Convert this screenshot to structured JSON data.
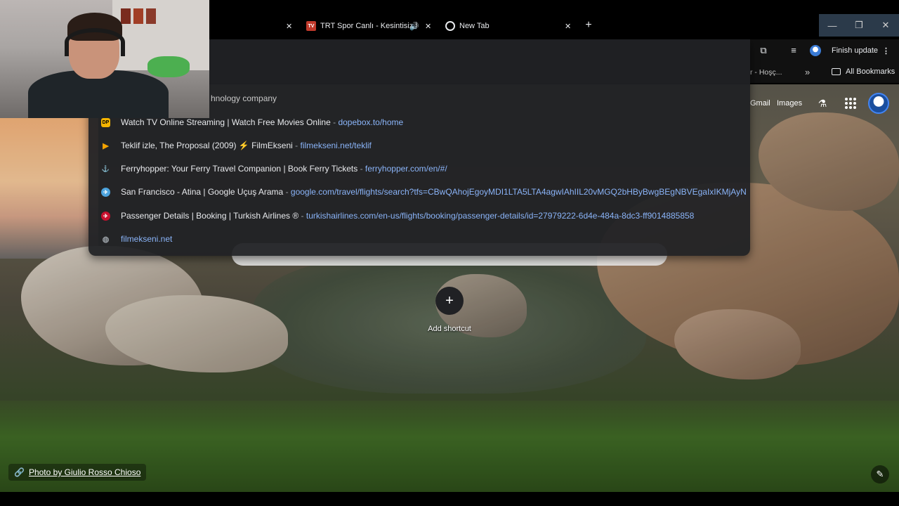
{
  "tabs": [
    {
      "title": "",
      "favicon": ""
    },
    {
      "title": "TRT Spor Canlı - Kesintisiz İzle",
      "favicon": "TV",
      "favicon_color": "#c0392b",
      "audio": true
    },
    {
      "title": "New Tab",
      "favicon": "chrome-icon",
      "active": true
    }
  ],
  "toolbar": {
    "finish_update_label": "Finish update",
    "omnibox_text": "Technology company"
  },
  "bookmarks_bar": {
    "visible_item": "r - Hoşç...",
    "all_bookmarks_label": "All Bookmarks"
  },
  "omnibox": {
    "hint_text": "hnology company",
    "suggestions": [
      {
        "icon": "DP",
        "icon_color": "#f4b400",
        "title": "Watch TV Online Streaming | Watch Free Movies Online",
        "url": "dopebox.to/home"
      },
      {
        "icon": "▶",
        "icon_color": "#f4a300",
        "title": "Teklif izle, The Proposal (2009) ⚡ FilmEkseni",
        "url": "filmekseni.net/teklif"
      },
      {
        "icon": "⚓",
        "icon_color": "#1e3a2a",
        "title": "Ferryhopper: Your Ferry Travel Companion | Book Ferry Tickets",
        "url": "ferryhopper.com/en/#/"
      },
      {
        "icon": "✈",
        "icon_color": "#4ca3dd",
        "title": "San Francisco - Atina | Google Uçuş Arama",
        "url": "google.com/travel/flights/search?tfs=CBwQAhojEgoyMDI1LTA5LTA4agwIAhIIL20vMGQ2bHByBwgBEgNBVEgaIxIKMjAyNS0x..."
      },
      {
        "icon": "✈",
        "icon_color": "#c8102e",
        "title": "Passenger Details | Booking | Turkish Airlines ®",
        "url": "turkishairlines.com/en-us/flights/booking/passenger-details/id=27979222-6d4e-484a-8dc3-ff9014885858"
      },
      {
        "icon": "🌐",
        "icon_color": "#9aa0a6",
        "title": "",
        "url": "filmekseni.net"
      }
    ]
  },
  "ntp": {
    "gmail_label": "Gmail",
    "images_label": "Images",
    "add_shortcut_label": "Add shortcut",
    "photo_credit": "Photo by Giulio Rosso Chioso"
  }
}
